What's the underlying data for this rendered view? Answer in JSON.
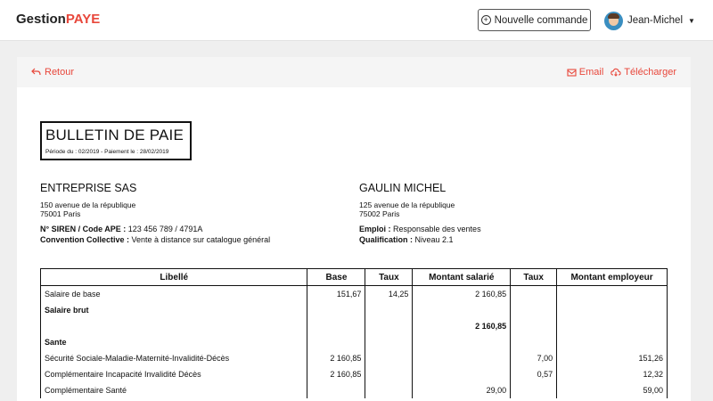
{
  "header": {
    "logo_main": "Gestion",
    "logo_accent": "PAYE",
    "new_order_label": "Nouvelle commande",
    "user_name": "Jean-Michel"
  },
  "card_header": {
    "back_label": "Retour",
    "email_label": "Email",
    "download_label": "Télécharger"
  },
  "payslip": {
    "title": "BULLETIN DE PAIE",
    "period": "Période du : 02/2019 - Paiement le : 28/02/2019",
    "employer": {
      "name": "ENTREPRISE SAS",
      "address_line1": "150 avenue de la république",
      "address_line2": "75001 Paris",
      "siren_label": "N° SIREN / Code APE :",
      "siren_value": " 123 456 789 / 4791A",
      "convention_label": "Convention Collective :",
      "convention_value": " Vente à distance sur catalogue général"
    },
    "employee": {
      "name": "GAULIN MICHEL",
      "address_line1": "125 avenue de la république",
      "address_line2": "75002 Paris",
      "job_label": "Emploi :",
      "job_value": " Responsable des ventes",
      "qualification_label": "Qualification :",
      "qualification_value": " Niveau 2.1"
    },
    "table": {
      "headers": [
        "Libellé",
        "Base",
        "Taux",
        "Montant salarié",
        "Taux",
        "Montant employeur"
      ],
      "rows": [
        {
          "label": "Salaire de base",
          "base": "151,67",
          "taux": "14,25",
          "montant_salarie": "2 160,85",
          "taux_employeur": "",
          "montant_employeur": ""
        },
        {
          "label": "Salaire brut",
          "base": "",
          "taux": "",
          "montant_salarie": "",
          "taux_employeur": "",
          "montant_employeur": ""
        },
        {
          "label": "",
          "base": "",
          "taux": "",
          "montant_salarie": "2 160,85",
          "taux_employeur": "",
          "montant_employeur": ""
        },
        {
          "label": "Sante",
          "base": "",
          "taux": "",
          "montant_salarie": "",
          "taux_employeur": "",
          "montant_employeur": ""
        },
        {
          "label": "Sécurité Sociale-Maladie-Maternité-Invalidité-Décès",
          "base": "2 160,85",
          "taux": "",
          "montant_salarie": "",
          "taux_employeur": "7,00",
          "montant_employeur": "151,26"
        },
        {
          "label": "Complémentaire Incapacité Invalidité Décès",
          "base": "2 160,85",
          "taux": "",
          "montant_salarie": "",
          "taux_employeur": "0,57",
          "montant_employeur": "12,32"
        },
        {
          "label": "Complémentaire Santé",
          "base": "",
          "taux": "",
          "montant_salarie": "29,00",
          "taux_employeur": "",
          "montant_employeur": "59,00"
        }
      ]
    }
  },
  "colors": {
    "accent": "#e8473b",
    "background": "#efefef"
  }
}
